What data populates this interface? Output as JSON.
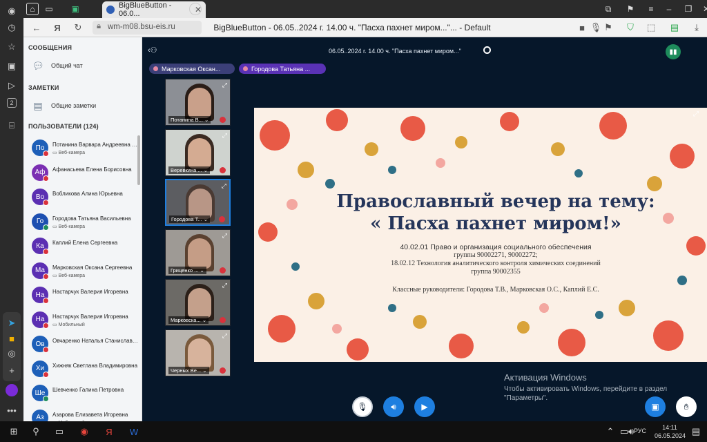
{
  "browser": {
    "tab_title": "BigBlueButton - 06.0...",
    "url": "wm-m08.bsu-eis.ru",
    "page_title": "BigBlueButton - 06.05..2024 г. 14.00 ч. \"Пасха пахнет миром...\"... - Default",
    "yandex_letter": "Я",
    "rail_badge": "2"
  },
  "sidebar": {
    "messages_header": "СООБЩЕНИЯ",
    "public_chat": "Общий чат",
    "notes_header": "ЗАМЕТКИ",
    "shared_notes": "Общие заметки",
    "users_header": "ПОЛЬЗОВАТЕЛИ (124)",
    "users": [
      {
        "initials": "По",
        "name": "Потанина Варвара Андреевна",
        "you": "(Вы)",
        "sub": "Веб-камера",
        "color": "#1d5fb8",
        "mic": "muted"
      },
      {
        "initials": "Аф",
        "name": "Афанасьева Елена Борисовна",
        "sub": "",
        "color": "#7b2fb2",
        "mic": "muted"
      },
      {
        "initials": "Во",
        "name": "Вобликова Алина Юрьевна",
        "sub": "",
        "color": "#5b2fb2",
        "mic": "muted"
      },
      {
        "initials": "Го",
        "name": "Городова Татьяна Васильевна",
        "sub": "Веб-камера",
        "color": "#1d4fb0",
        "mic": "on"
      },
      {
        "initials": "Ка",
        "name": "Каплий Елена Сергеевна",
        "sub": "",
        "color": "#5b2fb2",
        "mic": "muted"
      },
      {
        "initials": "Ма",
        "name": "Марковская Оксана Сергеевна",
        "sub": "Веб-камера",
        "color": "#5b2fb2",
        "mic": "muted"
      },
      {
        "initials": "На",
        "name": "Настарчук Валерия Игоревна",
        "sub": "",
        "color": "#5b2fb2",
        "mic": "muted"
      },
      {
        "initials": "На",
        "name": "Настарчук Валерия Игоревна",
        "sub": "Мобильный",
        "color": "#5b2fb2",
        "mic": "muted"
      },
      {
        "initials": "Ов",
        "name": "Овчаренко Наталья Станиславовна",
        "sub": "",
        "color": "#1d5fb8",
        "mic": "muted"
      },
      {
        "initials": "Хи",
        "name": "Хижняк Светлана Владимировна",
        "sub": "",
        "color": "#1d5fb8",
        "mic": "muted"
      },
      {
        "initials": "Ше",
        "name": "Шевченко Галина Петровна",
        "sub": "",
        "color": "#1d5fb8",
        "mic": "on"
      },
      {
        "initials": "Аз",
        "name": "Азарова Елизавета Игоревна",
        "sub": "Мобильный",
        "color": "#1d5fb8",
        "mic": "none"
      }
    ]
  },
  "meeting": {
    "title": "06.05..2024 г. 14.00 ч. \"Пасха пахнет миром...\"",
    "talkers": [
      "Марковская Оксан...",
      "Городова Татьяна ..."
    ],
    "videos": [
      {
        "label": "Потанина В...",
        "skin": "#c9a08a",
        "hair": "#2a1d17",
        "bg": "#8c8f95",
        "active": false
      },
      {
        "label": "Веревкина ...",
        "skin": "#d4ab92",
        "hair": "#3a2a22",
        "bg": "#cfd3cf",
        "active": false
      },
      {
        "label": "Городова Т...",
        "skin": "#b89686",
        "hair": "#4a3a33",
        "bg": "#5c5d61",
        "active": true
      },
      {
        "label": "Гриценко ...",
        "skin": "#c59d86",
        "hair": "#5a4130",
        "bg": "#9e9a95",
        "active": false
      },
      {
        "label": "Марковска...",
        "skin": "#c4a08b",
        "hair": "#2c2019",
        "bg": "#6c6a66",
        "active": false
      },
      {
        "label": "Черных Ве...",
        "skin": "#d7b39c",
        "hair": "#7a5a3c",
        "bg": "#b8b4ae",
        "active": false
      }
    ]
  },
  "slide": {
    "title_line1": "Православный вечер на тему:",
    "title_line2": "« Пасха пахнет миром!»",
    "line1": "40.02.01 Право и организация социального обеспечения",
    "line2": "группы 90002271, 90002272;",
    "line3": "18.02.12 Технология аналитического контроля химических соединений",
    "line4": "группа 90002355",
    "line5": "Классные руководители: Городова Т.В., Марковская О.С., Каплий Е.С."
  },
  "activation": {
    "title": "Активация Windows",
    "text": "Чтобы активировать Windows, перейдите в раздел \"Параметры\"."
  },
  "taskbar": {
    "lang": "РУС",
    "time": "14:11",
    "date": "06.05.2024"
  }
}
